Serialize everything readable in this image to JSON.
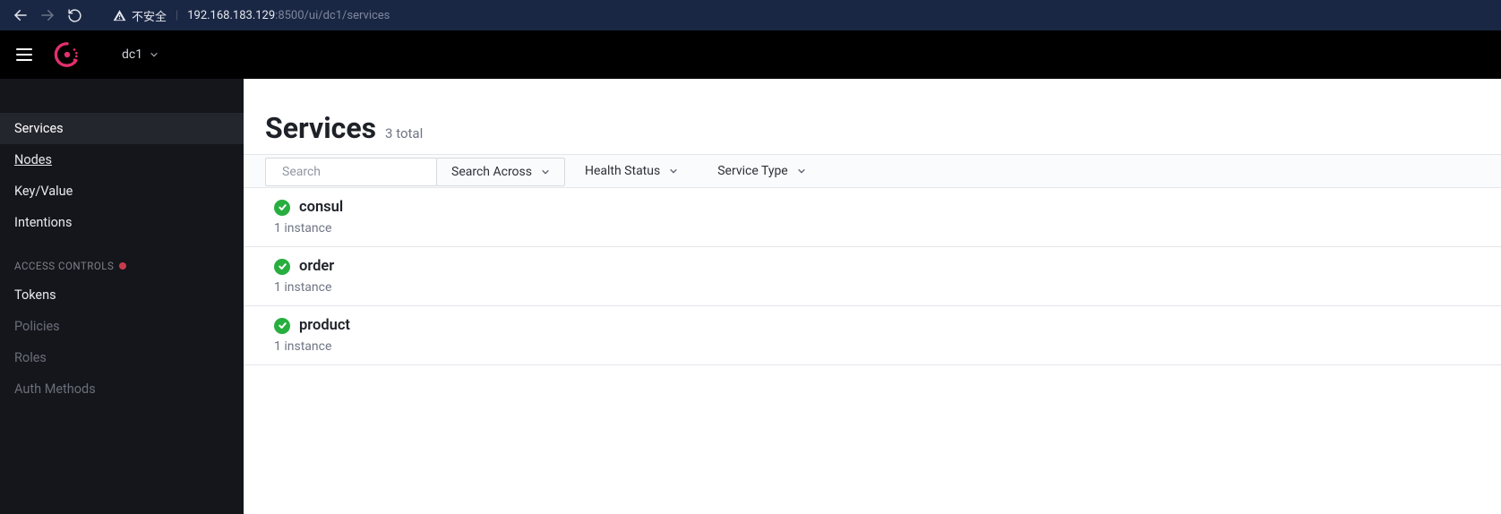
{
  "browser": {
    "security_label": "不安全",
    "url_host": "192.168.183.129",
    "url_path": ":8500/ui/dc1/services"
  },
  "header": {
    "datacenter": "dc1"
  },
  "sidebar": {
    "items": [
      {
        "label": "Services",
        "active": true
      },
      {
        "label": "Nodes",
        "underlined": true
      },
      {
        "label": "Key/Value"
      },
      {
        "label": "Intentions"
      }
    ],
    "section_label": "ACCESS CONTROLS",
    "acl_items": [
      {
        "label": "Tokens",
        "dim": false
      },
      {
        "label": "Policies",
        "dim": true
      },
      {
        "label": "Roles",
        "dim": true
      },
      {
        "label": "Auth Methods",
        "dim": true
      }
    ]
  },
  "main": {
    "title": "Services",
    "count_label": "3 total",
    "search_placeholder": "Search",
    "search_across_label": "Search Across",
    "filters": [
      {
        "label": "Health Status"
      },
      {
        "label": "Service Type"
      }
    ],
    "services": [
      {
        "name": "consul",
        "instances_label": "1 instance",
        "status": "passing"
      },
      {
        "name": "order",
        "instances_label": "1 instance",
        "status": "passing"
      },
      {
        "name": "product",
        "instances_label": "1 instance",
        "status": "passing"
      }
    ]
  },
  "colors": {
    "accent": "#e3306b",
    "pass": "#27ae3f"
  }
}
